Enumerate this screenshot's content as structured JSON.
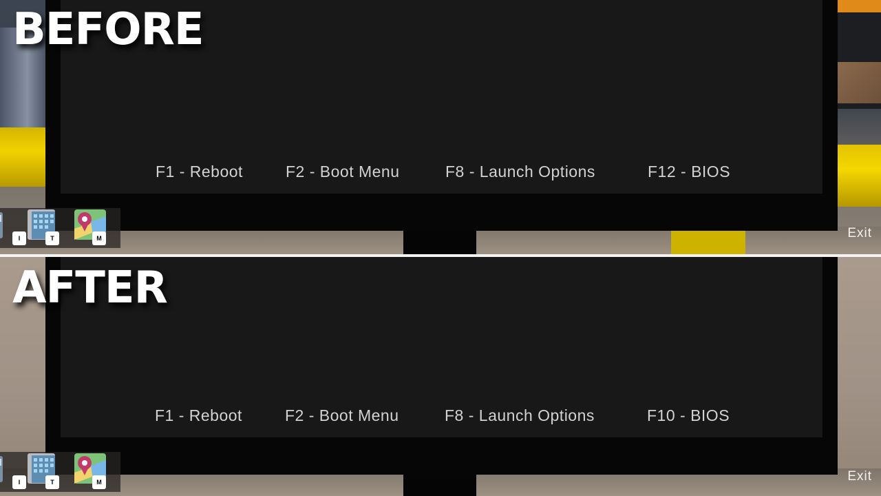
{
  "before": {
    "banner": "BEFORE",
    "fkeys": [
      {
        "label": "F1 - Reboot"
      },
      {
        "label": "F2 - Boot Menu"
      },
      {
        "label": "F8 - Launch Options"
      },
      {
        "label": "F12 - BIOS"
      }
    ],
    "hotbar": [
      {
        "key": "I",
        "icon": "inventory-icon"
      },
      {
        "key": "T",
        "icon": "tablet-icon"
      },
      {
        "key": "M",
        "icon": "map-icon"
      }
    ],
    "exit_label": "Exit"
  },
  "after": {
    "banner": "AFTER",
    "fkeys": [
      {
        "label": "F1 - Reboot"
      },
      {
        "label": "F2 - Boot Menu"
      },
      {
        "label": "F8 - Launch Options"
      },
      {
        "label": "F10 - BIOS"
      }
    ],
    "hotbar": [
      {
        "key": "I",
        "icon": "inventory-icon"
      },
      {
        "key": "T",
        "icon": "tablet-icon"
      },
      {
        "key": "M",
        "icon": "map-icon"
      }
    ],
    "exit_label": "Exit"
  },
  "colors": {
    "screen": "#181818",
    "bezel": "#060606",
    "fkey_text": "#d2d2d2",
    "banner_text": "#ffffff",
    "accent_yellow": "#f2d200"
  }
}
